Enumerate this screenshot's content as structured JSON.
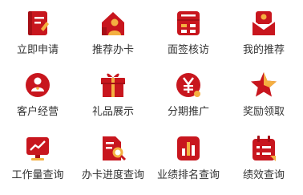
{
  "colors": {
    "primary": "#c8161e",
    "accent": "#f4b041",
    "text": "#333333"
  },
  "menu": {
    "items": [
      {
        "label": "立即申请",
        "icon": "apply-document-icon"
      },
      {
        "label": "推荐办卡",
        "icon": "recommend-card-icon"
      },
      {
        "label": "面签核访",
        "icon": "interview-verify-icon"
      },
      {
        "label": "我的推荐",
        "icon": "my-recommend-icon"
      },
      {
        "label": "客户经营",
        "icon": "customer-manage-icon"
      },
      {
        "label": "礼品展示",
        "icon": "gift-icon"
      },
      {
        "label": "分期推广",
        "icon": "installment-yen-icon"
      },
      {
        "label": "奖励领取",
        "icon": "reward-star-icon"
      },
      {
        "label": "工作量查询",
        "icon": "workload-chart-icon"
      },
      {
        "label": "办卡进度查询",
        "icon": "card-progress-icon"
      },
      {
        "label": "业绩排名查询",
        "icon": "performance-rank-icon"
      },
      {
        "label": "绩效查询",
        "icon": "kpi-calendar-icon"
      }
    ]
  }
}
